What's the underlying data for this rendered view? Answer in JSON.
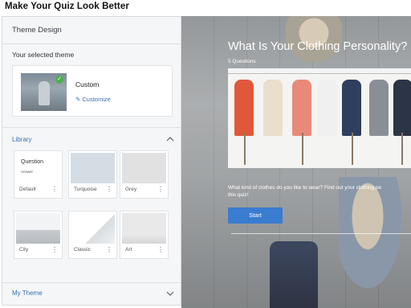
{
  "page": {
    "title": "Make Your Quiz Look Better"
  },
  "panel": {
    "header": "Theme Design",
    "selected_label": "Your selected theme",
    "selected": {
      "name": "Custom",
      "customize_label": "Customize",
      "checked": true
    },
    "library_label": "Library",
    "my_theme_label": "My Theme"
  },
  "themes": [
    {
      "label": "Default",
      "preview_title": "Question",
      "preview_sub": "Answer"
    },
    {
      "label": "Turquoise"
    },
    {
      "label": "Grey"
    },
    {
      "label": "City"
    },
    {
      "label": "Classic"
    },
    {
      "label": "Art"
    }
  ],
  "preview": {
    "title": "What Is Your Clothing Personality?",
    "count": "5 Questions",
    "description": "What kind of clothes do you like to wear? Find out your clothing pe",
    "description_line2": "this quiz!",
    "start_label": "Start"
  },
  "colors": {
    "accent": "#3a7cd0",
    "link": "#3a6fb0",
    "check": "#4caf50"
  },
  "icons": {
    "check": "check-icon",
    "customize": "pencil-icon",
    "menu": "more-vert-icon",
    "chevron_up": "chevron-up-icon",
    "chevron_down": "chevron-down-icon"
  }
}
